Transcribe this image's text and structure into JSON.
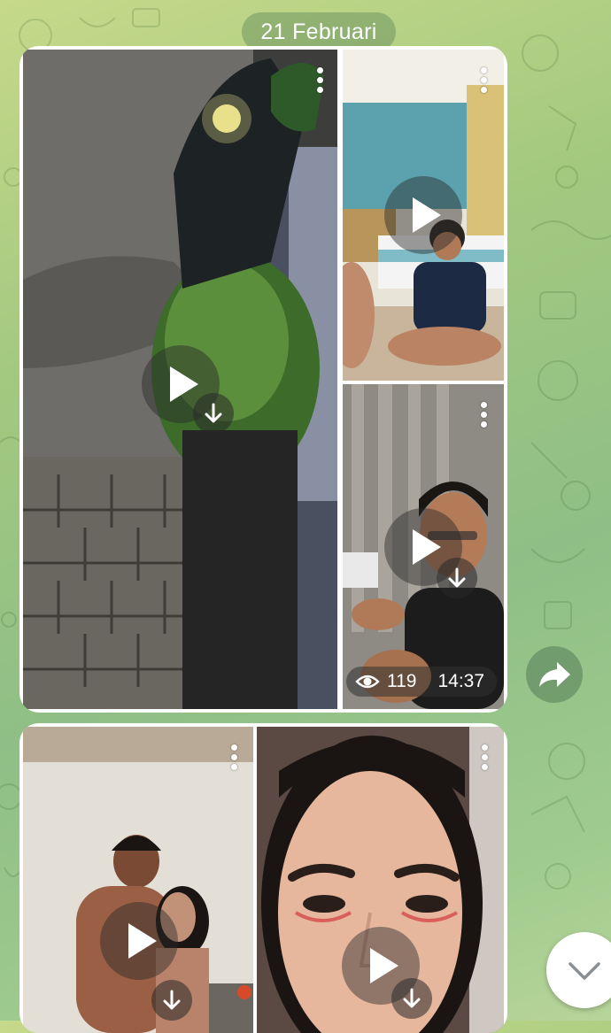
{
  "date_separator": "21 Februari",
  "album1": {
    "views": "119",
    "time": "14:37"
  },
  "icons": {
    "menu": "more-vertical-icon",
    "play": "play-icon",
    "download": "download-icon",
    "views": "eye-icon",
    "share": "forward-icon",
    "scroll": "chevron-down-icon"
  },
  "colors": {
    "bubble": "#ffffff",
    "overlay": "#2b2b2b"
  }
}
